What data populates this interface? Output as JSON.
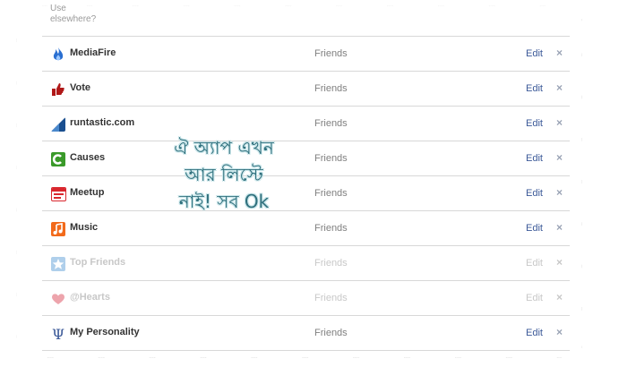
{
  "header": {
    "truncated_text_line1": "Use",
    "truncated_text_line2": "elsewhere?"
  },
  "apps": [
    {
      "name": "MediaFire",
      "privacy": "Friends",
      "edit": "Edit",
      "remove": "×",
      "icon": "flame-icon",
      "color": "#2a6fd1",
      "faded": false
    },
    {
      "name": "Vote",
      "privacy": "Friends",
      "edit": "Edit",
      "remove": "×",
      "icon": "thumbs-up-icon",
      "color": "#b01818",
      "faded": false
    },
    {
      "name": "runtastic.com",
      "privacy": "Friends",
      "edit": "Edit",
      "remove": "×",
      "icon": "runtastic-icon",
      "color": "#1a4f8f",
      "faded": false
    },
    {
      "name": "Causes",
      "privacy": "Friends",
      "edit": "Edit",
      "remove": "×",
      "icon": "causes-icon",
      "color": "#3a9a2a",
      "faded": false
    },
    {
      "name": "Meetup",
      "privacy": "Friends",
      "edit": "Edit",
      "remove": "×",
      "icon": "meetup-icon",
      "color": "#d9272e",
      "faded": false
    },
    {
      "name": "Music",
      "privacy": "Friends",
      "edit": "Edit",
      "remove": "×",
      "icon": "music-note-icon",
      "color": "#f26a1b",
      "faded": false
    },
    {
      "name": "Top Friends",
      "privacy": "Friends",
      "edit": "Edit",
      "remove": "×",
      "icon": "star-icon",
      "color": "#6fa8dc",
      "faded": true
    },
    {
      "name": "@Hearts",
      "privacy": "Friends",
      "edit": "Edit",
      "remove": "×",
      "icon": "heart-icon",
      "color": "#e05a6a",
      "faded": true
    },
    {
      "name": "My Personality",
      "privacy": "Friends",
      "edit": "Edit",
      "remove": "×",
      "icon": "psi-icon",
      "color": "#3b5998",
      "faded": false
    }
  ],
  "overlay_text": {
    "line1": "ঐ অ্যাপ এখন",
    "line2": "আর লিস্টে",
    "line3": "নাই! সব Ok"
  }
}
